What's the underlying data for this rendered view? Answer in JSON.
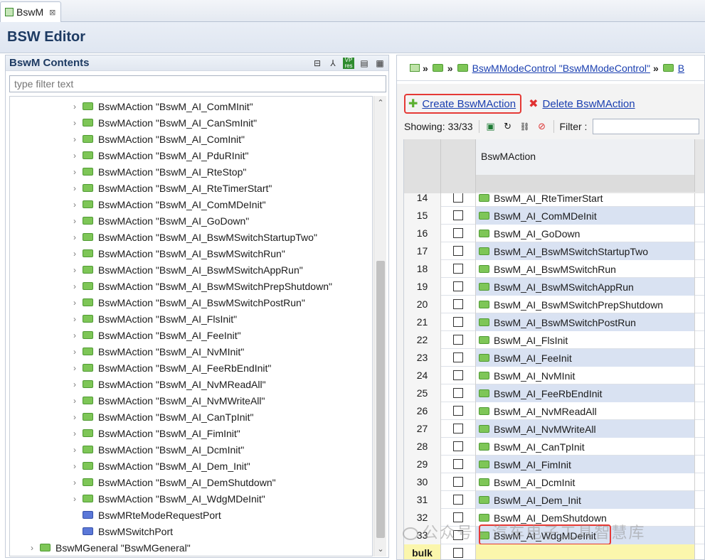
{
  "tab": {
    "label": "BswM",
    "close": "⊠"
  },
  "editor_title": "BSW Editor",
  "left": {
    "title": "BswM Contents",
    "filter_placeholder": "type filter text",
    "tools": [
      "collapse-all-icon",
      "hierarchy-icon",
      "vp-res-icon",
      "document-icon",
      "grid-icon"
    ],
    "tree": [
      {
        "label": "BswMAction \"BswM_AI_ComMInit\"",
        "level": 2,
        "folder": "green"
      },
      {
        "label": "BswMAction \"BswM_AI_CanSmInit\"",
        "level": 2,
        "folder": "green"
      },
      {
        "label": "BswMAction \"BswM_AI_ComInit\"",
        "level": 2,
        "folder": "green"
      },
      {
        "label": "BswMAction \"BswM_AI_PduRInit\"",
        "level": 2,
        "folder": "green"
      },
      {
        "label": "BswMAction \"BswM_AI_RteStop\"",
        "level": 2,
        "folder": "green"
      },
      {
        "label": "BswMAction \"BswM_AI_RteTimerStart\"",
        "level": 2,
        "folder": "green"
      },
      {
        "label": "BswMAction \"BswM_AI_ComMDeInit\"",
        "level": 2,
        "folder": "green"
      },
      {
        "label": "BswMAction \"BswM_AI_GoDown\"",
        "level": 2,
        "folder": "green"
      },
      {
        "label": "BswMAction \"BswM_AI_BswMSwitchStartupTwo\"",
        "level": 2,
        "folder": "green"
      },
      {
        "label": "BswMAction \"BswM_AI_BswMSwitchRun\"",
        "level": 2,
        "folder": "green"
      },
      {
        "label": "BswMAction \"BswM_AI_BswMSwitchAppRun\"",
        "level": 2,
        "folder": "green"
      },
      {
        "label": "BswMAction \"BswM_AI_BswMSwitchPrepShutdown\"",
        "level": 2,
        "folder": "green"
      },
      {
        "label": "BswMAction \"BswM_AI_BswMSwitchPostRun\"",
        "level": 2,
        "folder": "green"
      },
      {
        "label": "BswMAction \"BswM_AI_FlsInit\"",
        "level": 2,
        "folder": "green"
      },
      {
        "label": "BswMAction \"BswM_AI_FeeInit\"",
        "level": 2,
        "folder": "green"
      },
      {
        "label": "BswMAction \"BswM_AI_NvMInit\"",
        "level": 2,
        "folder": "green"
      },
      {
        "label": "BswMAction \"BswM_AI_FeeRbEndInit\"",
        "level": 2,
        "folder": "green"
      },
      {
        "label": "BswMAction \"BswM_AI_NvMReadAll\"",
        "level": 2,
        "folder": "green"
      },
      {
        "label": "BswMAction \"BswM_AI_NvMWriteAll\"",
        "level": 2,
        "folder": "green"
      },
      {
        "label": "BswMAction \"BswM_AI_CanTpInit\"",
        "level": 2,
        "folder": "green"
      },
      {
        "label": "BswMAction \"BswM_AI_FimInit\"",
        "level": 2,
        "folder": "green"
      },
      {
        "label": "BswMAction \"BswM_AI_DcmInit\"",
        "level": 2,
        "folder": "green"
      },
      {
        "label": "BswMAction \"BswM_AI_Dem_Init\"",
        "level": 2,
        "folder": "green"
      },
      {
        "label": "BswMAction \"BswM_AI_DemShutdown\"",
        "level": 2,
        "folder": "green"
      },
      {
        "label": "BswMAction \"BswM_AI_WdgMDeInit\"",
        "level": 2,
        "folder": "green"
      },
      {
        "label": "BswMRteModeRequestPort",
        "level": 1,
        "folder": "blue"
      },
      {
        "label": "BswMSwitchPort",
        "level": 1,
        "folder": "blue"
      },
      {
        "label": "BswMGeneral \"BswMGeneral\"",
        "level": 0,
        "folder": "green"
      }
    ]
  },
  "right": {
    "breadcrumb": {
      "link1": "BswMModeControl \"BswMModeControl\"",
      "link2": "B",
      "sep": "»"
    },
    "create_label": "Create BswMAction",
    "delete_label": "Delete BswMAction",
    "showing": "Showing: 33/33",
    "filter_label": "Filter :",
    "column_header": "BswMAction",
    "rows": [
      {
        "n": "14",
        "name": "BswM_AI_RteTimerStart"
      },
      {
        "n": "15",
        "name": "BswM_AI_ComMDeInit"
      },
      {
        "n": "16",
        "name": "BswM_AI_GoDown"
      },
      {
        "n": "17",
        "name": "BswM_AI_BswMSwitchStartupTwo"
      },
      {
        "n": "18",
        "name": "BswM_AI_BswMSwitchRun"
      },
      {
        "n": "19",
        "name": "BswM_AI_BswMSwitchAppRun"
      },
      {
        "n": "20",
        "name": "BswM_AI_BswMSwitchPrepShutdown"
      },
      {
        "n": "21",
        "name": "BswM_AI_BswMSwitchPostRun"
      },
      {
        "n": "22",
        "name": "BswM_AI_FlsInit"
      },
      {
        "n": "23",
        "name": "BswM_AI_FeeInit"
      },
      {
        "n": "24",
        "name": "BswM_AI_NvMInit"
      },
      {
        "n": "25",
        "name": "BswM_AI_FeeRbEndInit"
      },
      {
        "n": "26",
        "name": "BswM_AI_NvMReadAll"
      },
      {
        "n": "27",
        "name": "BswM_AI_NvMWriteAll"
      },
      {
        "n": "28",
        "name": "BswM_AI_CanTpInit"
      },
      {
        "n": "29",
        "name": "BswM_AI_FimInit"
      },
      {
        "n": "30",
        "name": "BswM_AI_DcmInit"
      },
      {
        "n": "31",
        "name": "BswM_AI_Dem_Init"
      },
      {
        "n": "32",
        "name": "BswM_AI_DemShutdown"
      },
      {
        "n": "33",
        "name": "BswM_AI_WdgMDeInit"
      }
    ],
    "bulk_label": "bulk"
  },
  "watermark": "公众号 · 汽车电子工具智慧库"
}
